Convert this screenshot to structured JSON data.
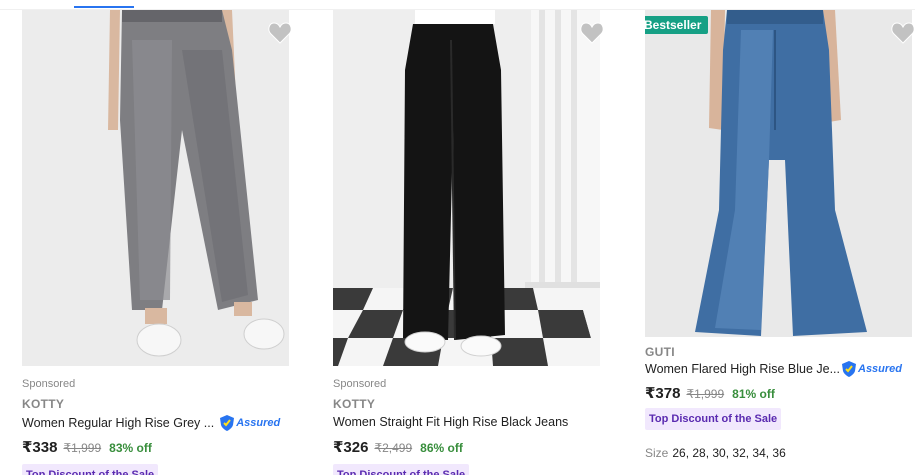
{
  "products": [
    {
      "sponsored": "Sponsored",
      "brand": "KOTTY",
      "title": "Women Regular High Rise Grey ...",
      "assured": "Assured",
      "price": "₹338",
      "mrp": "₹1,999",
      "off": "83% off",
      "tag": "Top Discount of the Sale"
    },
    {
      "sponsored": "Sponsored",
      "brand": "KOTTY",
      "title": "Women Straight Fit High Rise Black Jeans",
      "price": "₹326",
      "mrp": "₹2,499",
      "off": "86% off",
      "tag": "Top Discount of the Sale"
    },
    {
      "badge": "Bestseller",
      "brand": "GUTI",
      "title": "Women Flared High Rise Blue Je...",
      "assured": "Assured",
      "price": "₹378",
      "mrp": "₹1,999",
      "off": "81% off",
      "tag": "Top Discount of the Sale",
      "sizes_label": "Size",
      "sizes": "26, 28, 30, 32, 34, 36"
    }
  ],
  "colors": {
    "accent": "#2874f0",
    "discount": "#388e3c",
    "bestseller": "#16a085",
    "tag_bg": "#f1e8fd",
    "tag_text": "#5a2ab0"
  },
  "icons": [
    "heart-icon",
    "assured-shield-icon"
  ]
}
